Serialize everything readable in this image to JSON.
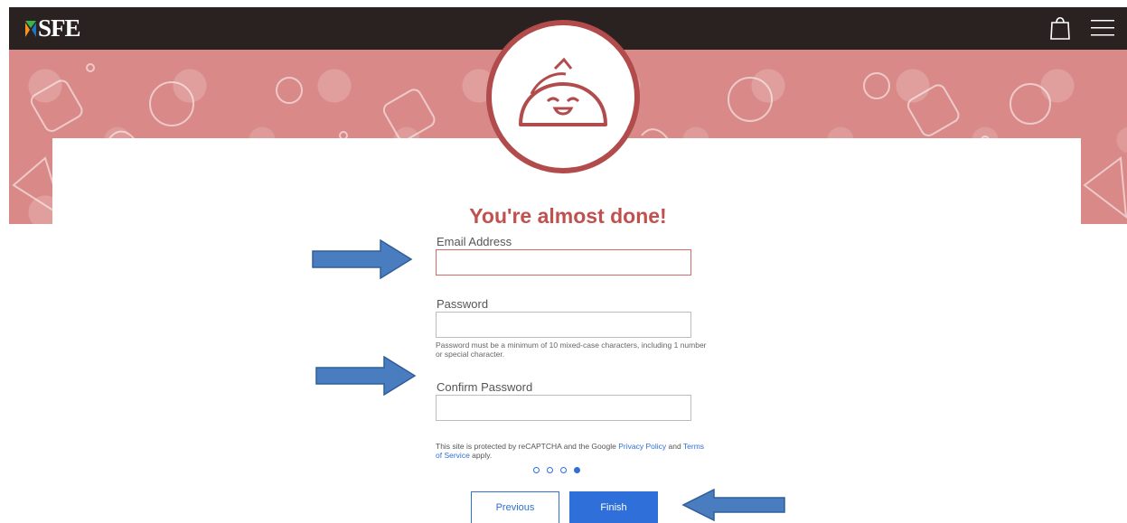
{
  "brand": {
    "logo_text": "SFE"
  },
  "header": {
    "bag_icon": "shopping-bag-icon",
    "menu_icon": "hamburger-menu-icon"
  },
  "badge": {
    "icon": "taco-icon"
  },
  "form": {
    "title": "You're almost done!",
    "email_label": "Email Address",
    "email_value": "",
    "password_label": "Password",
    "password_value": "",
    "password_hint": "Password must be a minimum of 10 mixed-case characters, including 1 number or special character.",
    "confirm_label": "Confirm Password",
    "confirm_value": ""
  },
  "legal": {
    "prefix": "This site is protected by reCAPTCHA and the Google ",
    "privacy_link": "Privacy Policy",
    "middle": " and ",
    "terms_link": "Terms of Service",
    "suffix": " apply."
  },
  "steps": {
    "total": 4,
    "current": 4
  },
  "buttons": {
    "previous": "Previous",
    "finish": "Finish"
  },
  "colors": {
    "nav_bg": "#2a2121",
    "banner_bg": "#d98a88",
    "accent": "#c0514e",
    "primary_blue": "#2e6fd9",
    "annotation_arrow": "#4a7dc0"
  }
}
